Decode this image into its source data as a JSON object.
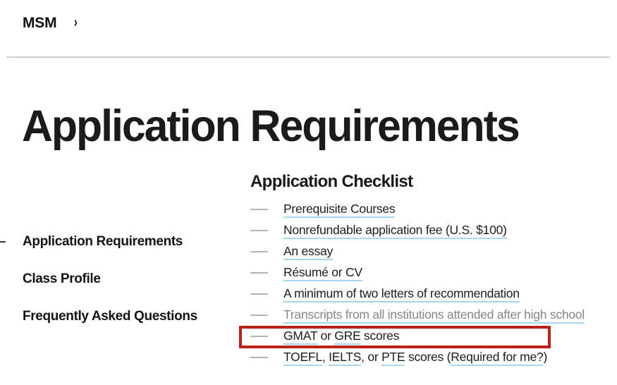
{
  "breadcrumb": {
    "crumb_label": "MSM",
    "chevron_glyph": "›",
    "chevron_icon_name": "chevron-right-icon"
  },
  "page": {
    "title": "Application Requirements"
  },
  "sidebar": {
    "items": [
      {
        "label": "Application Requirements",
        "active": true
      },
      {
        "label": "Class Profile",
        "active": false
      },
      {
        "label": "Frequently Asked Questions",
        "active": false
      }
    ]
  },
  "checklist": {
    "heading": "Application Checklist",
    "bullet_glyph": "—",
    "items": [
      {
        "muted": false,
        "highlighted": false,
        "parts": [
          {
            "text": "Prerequisite Courses",
            "link": true
          }
        ]
      },
      {
        "muted": false,
        "highlighted": false,
        "parts": [
          {
            "text": "Nonrefundable application fee (U.S. $100)",
            "link": true
          }
        ]
      },
      {
        "muted": false,
        "highlighted": false,
        "parts": [
          {
            "text": "An essay",
            "link": true
          }
        ]
      },
      {
        "muted": false,
        "highlighted": false,
        "parts": [
          {
            "text": "Résumé or CV",
            "link": true
          }
        ]
      },
      {
        "muted": false,
        "highlighted": false,
        "parts": [
          {
            "text": "A minimum of two letters of recommendation",
            "link": true
          }
        ]
      },
      {
        "muted": true,
        "highlighted": false,
        "parts": [
          {
            "text": "Transcripts from all institutions attended after high school",
            "link": true
          }
        ]
      },
      {
        "muted": false,
        "highlighted": true,
        "parts": [
          {
            "text": "GMAT",
            "link": true
          },
          {
            "text": " or ",
            "link": false
          },
          {
            "text": "GRE",
            "link": true
          },
          {
            "text": " scores",
            "link": false
          }
        ]
      },
      {
        "muted": false,
        "highlighted": false,
        "parts": [
          {
            "text": "TOEFL",
            "link": true
          },
          {
            "text": ", ",
            "link": false
          },
          {
            "text": "IELTS",
            "link": true
          },
          {
            "text": ", or ",
            "link": false
          },
          {
            "text": "PTE",
            "link": true
          },
          {
            "text": " scores (",
            "link": false
          },
          {
            "text": "Required for me?",
            "link": true
          },
          {
            "text": ")",
            "link": false
          }
        ]
      }
    ]
  },
  "highlight": {
    "color": "#bb2318",
    "target_label": "GMAT or GRE scores"
  },
  "colors": {
    "background": "#ffffff",
    "text": "#1c1c1c",
    "muted_text": "#868686",
    "link_underline": "#a5d6f2",
    "divider": "#cfcfcf",
    "bullet_dash": "#b6b6b6"
  }
}
